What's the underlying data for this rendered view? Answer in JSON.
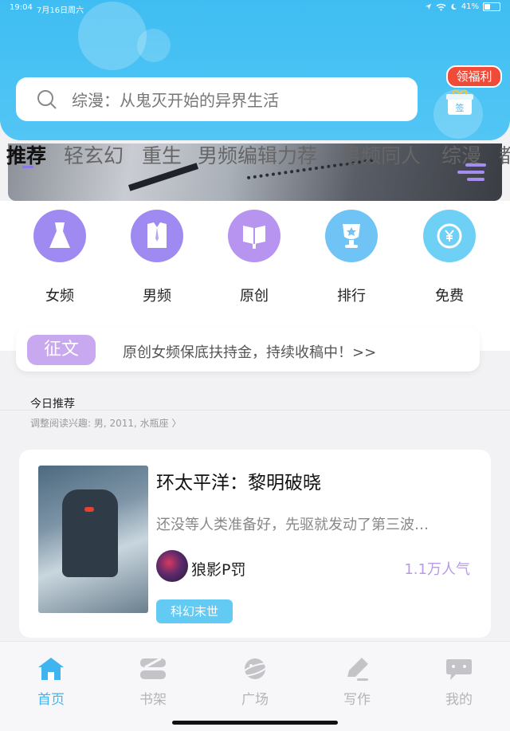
{
  "status_bar": {
    "time": "19:04",
    "date": "7月16日周六",
    "battery": "41%"
  },
  "search": {
    "text": "综漫：从鬼灭开始的异界生活"
  },
  "welfare": {
    "label": "领福利",
    "sign_label": "签"
  },
  "tabs": [
    {
      "label": "推荐",
      "active": true
    },
    {
      "label": "轻玄幻",
      "active": false
    },
    {
      "label": "重生",
      "active": false
    },
    {
      "label": "男频编辑力荐",
      "active": false
    },
    {
      "label": "男频同人",
      "active": false
    },
    {
      "label": "综漫",
      "active": false
    },
    {
      "label": "都",
      "active": false
    }
  ],
  "quick_entries": [
    {
      "label": "女频",
      "icon": "dress-icon",
      "color": "#9f8af2"
    },
    {
      "label": "男频",
      "icon": "shirt-icon",
      "color": "#9f8af2"
    },
    {
      "label": "原创",
      "icon": "book-icon",
      "color": "#b794f0"
    },
    {
      "label": "排行",
      "icon": "trophy-icon",
      "color": "#6fc4f5"
    },
    {
      "label": "免费",
      "icon": "yen-icon",
      "color": "#6fd0f5"
    }
  ],
  "notice": {
    "tag": "征文",
    "text": "原创女频保底扶持金，持续收稿中！>>"
  },
  "section": {
    "title": "今日推荐",
    "subtitle": "调整阅读兴趣: 男, 2011, 水瓶座 〉"
  },
  "book": {
    "title": "环太平洋：黎明破晓",
    "desc": "还没等人类准备好，先驱就发动了第三波…",
    "author": "狼影P罚",
    "popularity": "1.1万人气",
    "tag": "科幻末世"
  },
  "nav": [
    {
      "label": "首页",
      "icon": "home-icon",
      "active": true
    },
    {
      "label": "书架",
      "icon": "bookshelf-icon",
      "active": false
    },
    {
      "label": "广场",
      "icon": "planet-icon",
      "active": false
    },
    {
      "label": "写作",
      "icon": "pen-icon",
      "active": false
    },
    {
      "label": "我的",
      "icon": "chat-icon",
      "active": false
    }
  ],
  "colors": {
    "header": "#42bff3",
    "accent": "#8b77e8",
    "nav_active": "#3fb4ee",
    "tag": "#62caf3"
  }
}
